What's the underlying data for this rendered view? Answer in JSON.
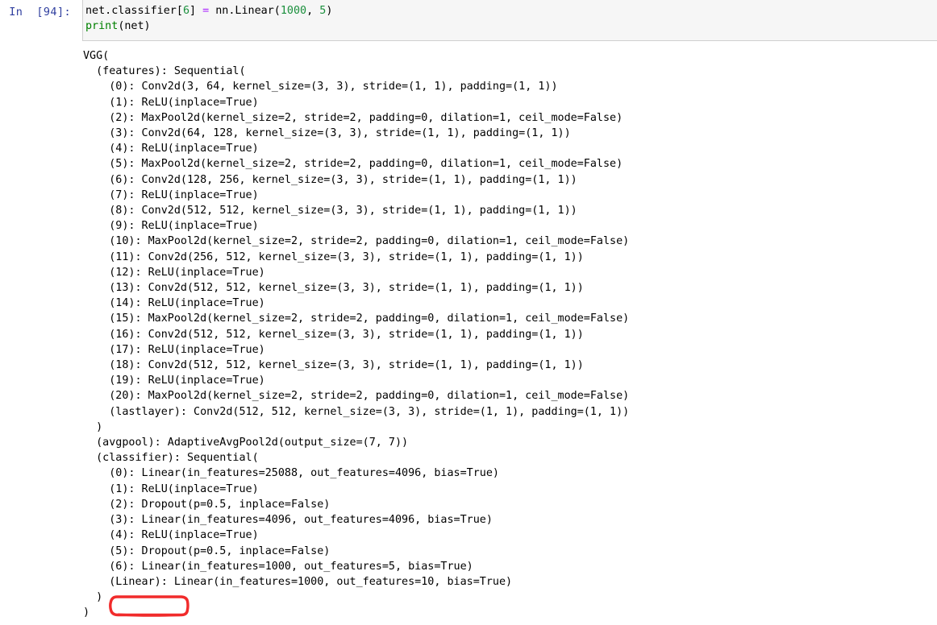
{
  "cell": {
    "prompt_label": "In  [94]:",
    "execution_count": "94",
    "code_lines": [
      {
        "tokens": [
          {
            "t": "net.classifier[",
            "c": "plain"
          },
          {
            "t": "6",
            "c": "num"
          },
          {
            "t": "] ",
            "c": "plain"
          },
          {
            "t": "=",
            "c": "op"
          },
          {
            "t": " nn.Linear(",
            "c": "plain"
          },
          {
            "t": "1000",
            "c": "num"
          },
          {
            "t": ", ",
            "c": "plain"
          },
          {
            "t": "5",
            "c": "num"
          },
          {
            "t": ")",
            "c": "plain"
          }
        ]
      },
      {
        "tokens": [
          {
            "t": "print",
            "c": "builtin"
          },
          {
            "t": "(net)",
            "c": "plain"
          }
        ]
      }
    ],
    "code_plain": "net.classifier[6] = nn.Linear(1000, 5)\nprint(net)"
  },
  "output": {
    "lines": [
      "VGG(",
      "  (features): Sequential(",
      "    (0): Conv2d(3, 64, kernel_size=(3, 3), stride=(1, 1), padding=(1, 1))",
      "    (1): ReLU(inplace=True)",
      "    (2): MaxPool2d(kernel_size=2, stride=2, padding=0, dilation=1, ceil_mode=False)",
      "    (3): Conv2d(64, 128, kernel_size=(3, 3), stride=(1, 1), padding=(1, 1))",
      "    (4): ReLU(inplace=True)",
      "    (5): MaxPool2d(kernel_size=2, stride=2, padding=0, dilation=1, ceil_mode=False)",
      "    (6): Conv2d(128, 256, kernel_size=(3, 3), stride=(1, 1), padding=(1, 1))",
      "    (7): ReLU(inplace=True)",
      "    (8): Conv2d(512, 512, kernel_size=(3, 3), stride=(1, 1), padding=(1, 1))",
      "    (9): ReLU(inplace=True)",
      "    (10): MaxPool2d(kernel_size=2, stride=2, padding=0, dilation=1, ceil_mode=False)",
      "    (11): Conv2d(256, 512, kernel_size=(3, 3), stride=(1, 1), padding=(1, 1))",
      "    (12): ReLU(inplace=True)",
      "    (13): Conv2d(512, 512, kernel_size=(3, 3), stride=(1, 1), padding=(1, 1))",
      "    (14): ReLU(inplace=True)",
      "    (15): MaxPool2d(kernel_size=2, stride=2, padding=0, dilation=1, ceil_mode=False)",
      "    (16): Conv2d(512, 512, kernel_size=(3, 3), stride=(1, 1), padding=(1, 1))",
      "    (17): ReLU(inplace=True)",
      "    (18): Conv2d(512, 512, kernel_size=(3, 3), stride=(1, 1), padding=(1, 1))",
      "    (19): ReLU(inplace=True)",
      "    (20): MaxPool2d(kernel_size=2, stride=2, padding=0, dilation=1, ceil_mode=False)",
      "    (lastlayer): Conv2d(512, 512, kernel_size=(3, 3), stride=(1, 1), padding=(1, 1))",
      "  )",
      "  (avgpool): AdaptiveAvgPool2d(output_size=(7, 7))",
      "  (classifier): Sequential(",
      "    (0): Linear(in_features=25088, out_features=4096, bias=True)",
      "    (1): ReLU(inplace=True)",
      "    (2): Dropout(p=0.5, inplace=False)",
      "    (3): Linear(in_features=4096, out_features=4096, bias=True)",
      "    (4): ReLU(inplace=True)",
      "    (5): Dropout(p=0.5, inplace=False)",
      "    (6): Linear(in_features=1000, out_features=5, bias=True)",
      "    (Linear): Linear(in_features=1000, out_features=10, bias=True)",
      "  )",
      ")"
    ]
  },
  "annotation": {
    "kind": "hand-drawn-red-rounded-rectangle",
    "highlighted_text": "(6): Linear",
    "color": "#F12B2B"
  },
  "colors": {
    "prompt": "#303F9F",
    "cell_background": "#f6f6f6",
    "cell_border": "#cfcfcf",
    "page_background": "#ffffff",
    "text": "#000000",
    "number_token": "#1a8f3c",
    "operator_token": "#aa22ff",
    "builtin_token": "#008000",
    "annotation_red": "#F12B2B"
  }
}
